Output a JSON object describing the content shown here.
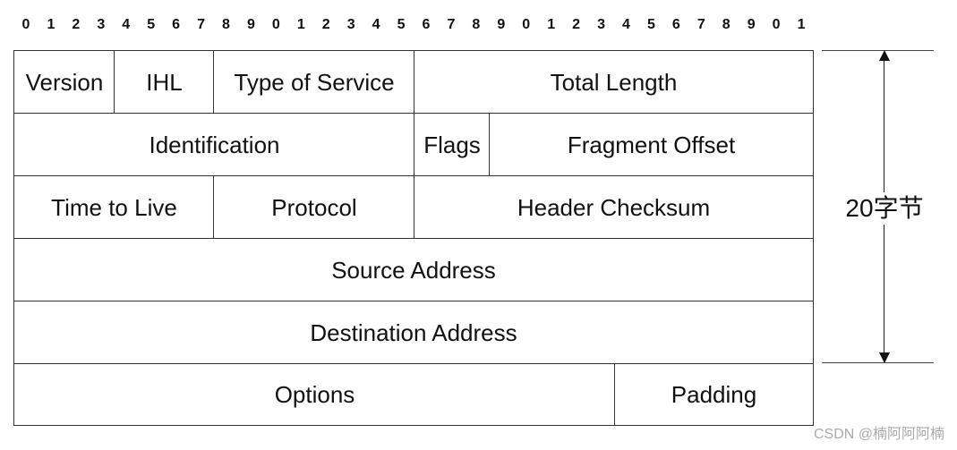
{
  "bit_numbers": [
    "0",
    "1",
    "2",
    "3",
    "4",
    "5",
    "6",
    "7",
    "8",
    "9",
    "0",
    "1",
    "2",
    "3",
    "4",
    "5",
    "6",
    "7",
    "8",
    "9",
    "0",
    "1",
    "2",
    "3",
    "4",
    "5",
    "6",
    "7",
    "8",
    "9",
    "0",
    "1"
  ],
  "fields": {
    "version": "Version",
    "ihl": "IHL",
    "type_of_service": "Type of Service",
    "total_length": "Total Length",
    "identification": "Identification",
    "flags": "Flags",
    "fragment_offset": "Fragment Offset",
    "time_to_live": "Time to Live",
    "protocol": "Protocol",
    "header_checksum": "Header Checksum",
    "source_address": "Source Address",
    "destination_address": "Destination Address",
    "options": "Options",
    "padding": "Padding"
  },
  "header_size_label": "20字节",
  "watermark": "CSDN @楠阿阿阿楠"
}
